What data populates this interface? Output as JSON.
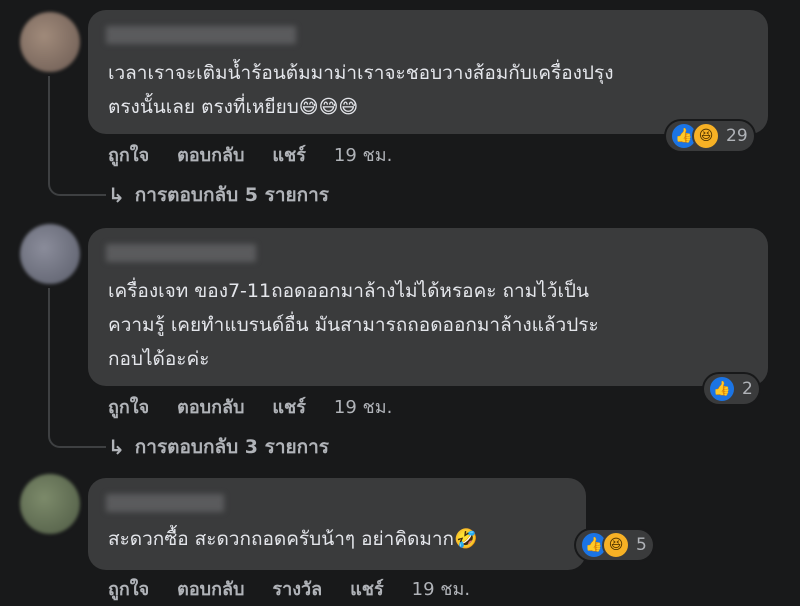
{
  "comments": [
    {
      "text": "เวลาเราจะเติมน้ำร้อนต้มมาม่าเราจะชอบวางส้อมกับเครื่องปรุง\nตรงนั้นเลย ตรงที่เหยียบ😅😅😅",
      "reaction_count": "29",
      "reaction_icons": [
        "like-icon",
        "haha-icon"
      ],
      "actions": {
        "like": "ถูกใจ",
        "reply": "ตอบกลับ",
        "share": "แชร์",
        "time": "19 ชม."
      },
      "replies_label": "การตอบกลับ 5 รายการ"
    },
    {
      "text": "เครื่องเจท ของ7-11ถอดออกมาล้างไม่ได้หรอคะ ถามไว้เป็น\nความรู้ เคยทำแบรนด์อื่น มันสามารถถอดออกมาล้างแล้วประ\nกอบได้อะค่ะ",
      "reaction_count": "2",
      "reaction_icons": [
        "like-icon"
      ],
      "actions": {
        "like": "ถูกใจ",
        "reply": "ตอบกลับ",
        "share": "แชร์",
        "time": "19 ชม."
      },
      "replies_label": "การตอบกลับ 3 รายการ"
    },
    {
      "text": "สะดวกซื้อ สะดวกถอดครับน้าๆ อย่าคิดมาก🤣",
      "reaction_count": "5",
      "reaction_icons": [
        "like-icon",
        "haha-icon"
      ],
      "actions": {
        "like": "ถูกใจ",
        "reply": "ตอบกลับ",
        "award": "รางวัล",
        "share": "แชร์",
        "time": "19 ชม."
      }
    }
  ],
  "colors": {
    "background": "#18191a",
    "bubble": "#3a3b3c",
    "text": "#e4e6eb",
    "secondary_text": "#b0b3b8",
    "like_blue": "#1b74e4",
    "haha_yellow": "#f7b125"
  }
}
